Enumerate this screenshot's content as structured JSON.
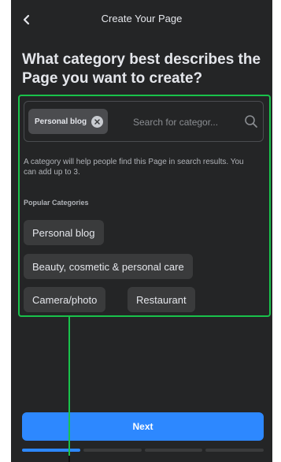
{
  "header": {
    "title": "Create Your Page",
    "back_icon": "chevron-left-icon"
  },
  "question": "What category best describes the Page you want to create?",
  "search": {
    "selected_chips": [
      "Personal blog"
    ],
    "placeholder": "Search for categor...",
    "value": "",
    "icon": "search-icon"
  },
  "helper_text": "A category will help people find this Page in search results. You can add up to 3.",
  "popular": {
    "heading": "Popular Categories",
    "items": [
      "Personal blog",
      "Beauty, cosmetic & personal care",
      "Camera/photo",
      "Restaurant"
    ]
  },
  "next_label": "Next",
  "progress": {
    "steps": 4,
    "current": 1
  },
  "colors": {
    "background": "#242526",
    "accent": "#2d88ff",
    "highlight": "#19c24b",
    "chip": "#3a3b3c"
  }
}
